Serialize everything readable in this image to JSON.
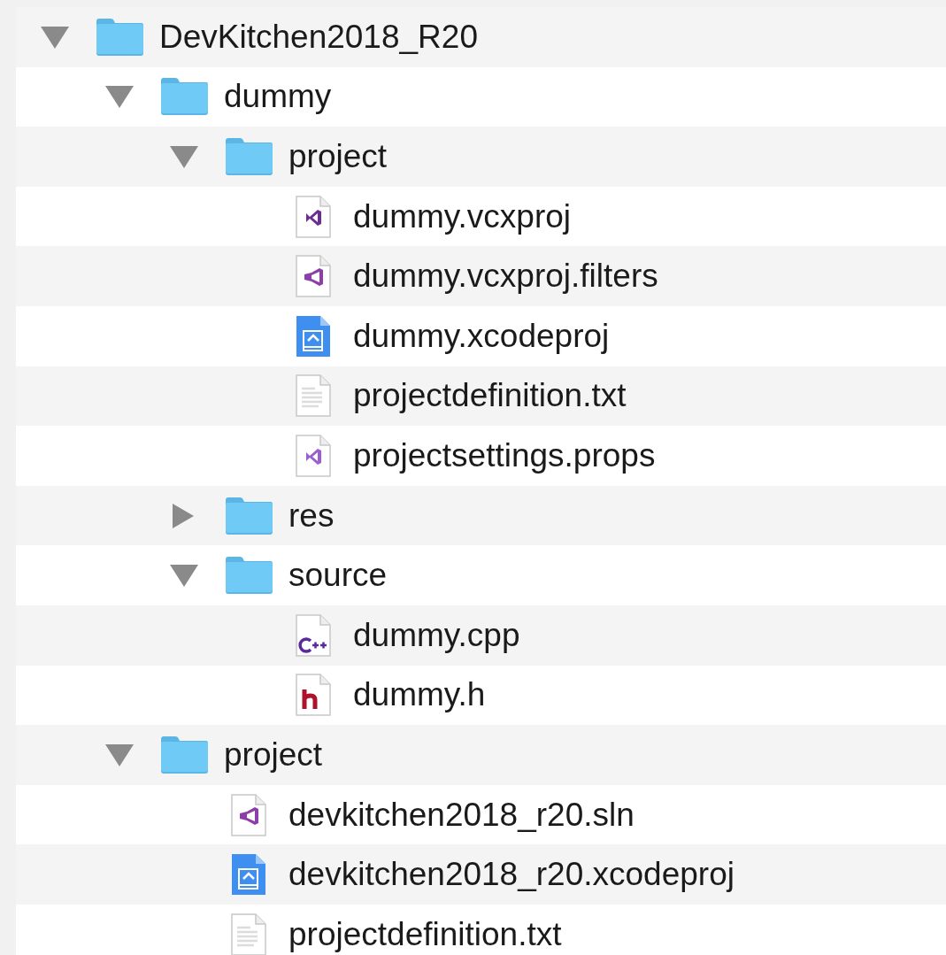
{
  "tree": [
    {
      "kind": "folder",
      "name": "DevKitchen2018_R20",
      "expanded": true,
      "children": [
        {
          "kind": "folder",
          "name": "dummy",
          "expanded": true,
          "children": [
            {
              "kind": "folder",
              "name": "project",
              "expanded": true,
              "children": [
                {
                  "kind": "vcxproj",
                  "name": "dummy.vcxproj"
                },
                {
                  "kind": "filters",
                  "name": "dummy.vcxproj.filters"
                },
                {
                  "kind": "xcode",
                  "name": "dummy.xcodeproj"
                },
                {
                  "kind": "text",
                  "name": "projectdefinition.txt"
                },
                {
                  "kind": "props",
                  "name": "projectsettings.props"
                }
              ]
            },
            {
              "kind": "folder",
              "name": "res",
              "expanded": false
            },
            {
              "kind": "folder",
              "name": "source",
              "expanded": true,
              "children": [
                {
                  "kind": "cpp",
                  "name": "dummy.cpp"
                },
                {
                  "kind": "header",
                  "name": "dummy.h"
                }
              ]
            }
          ]
        },
        {
          "kind": "folder",
          "name": "project",
          "expanded": true,
          "children": [
            {
              "kind": "sln",
              "name": "devkitchen2018_r20.sln"
            },
            {
              "kind": "xcode",
              "name": "devkitchen2018_r20.xcodeproj"
            },
            {
              "kind": "text",
              "name": "projectdefinition.txt"
            }
          ]
        }
      ]
    }
  ]
}
